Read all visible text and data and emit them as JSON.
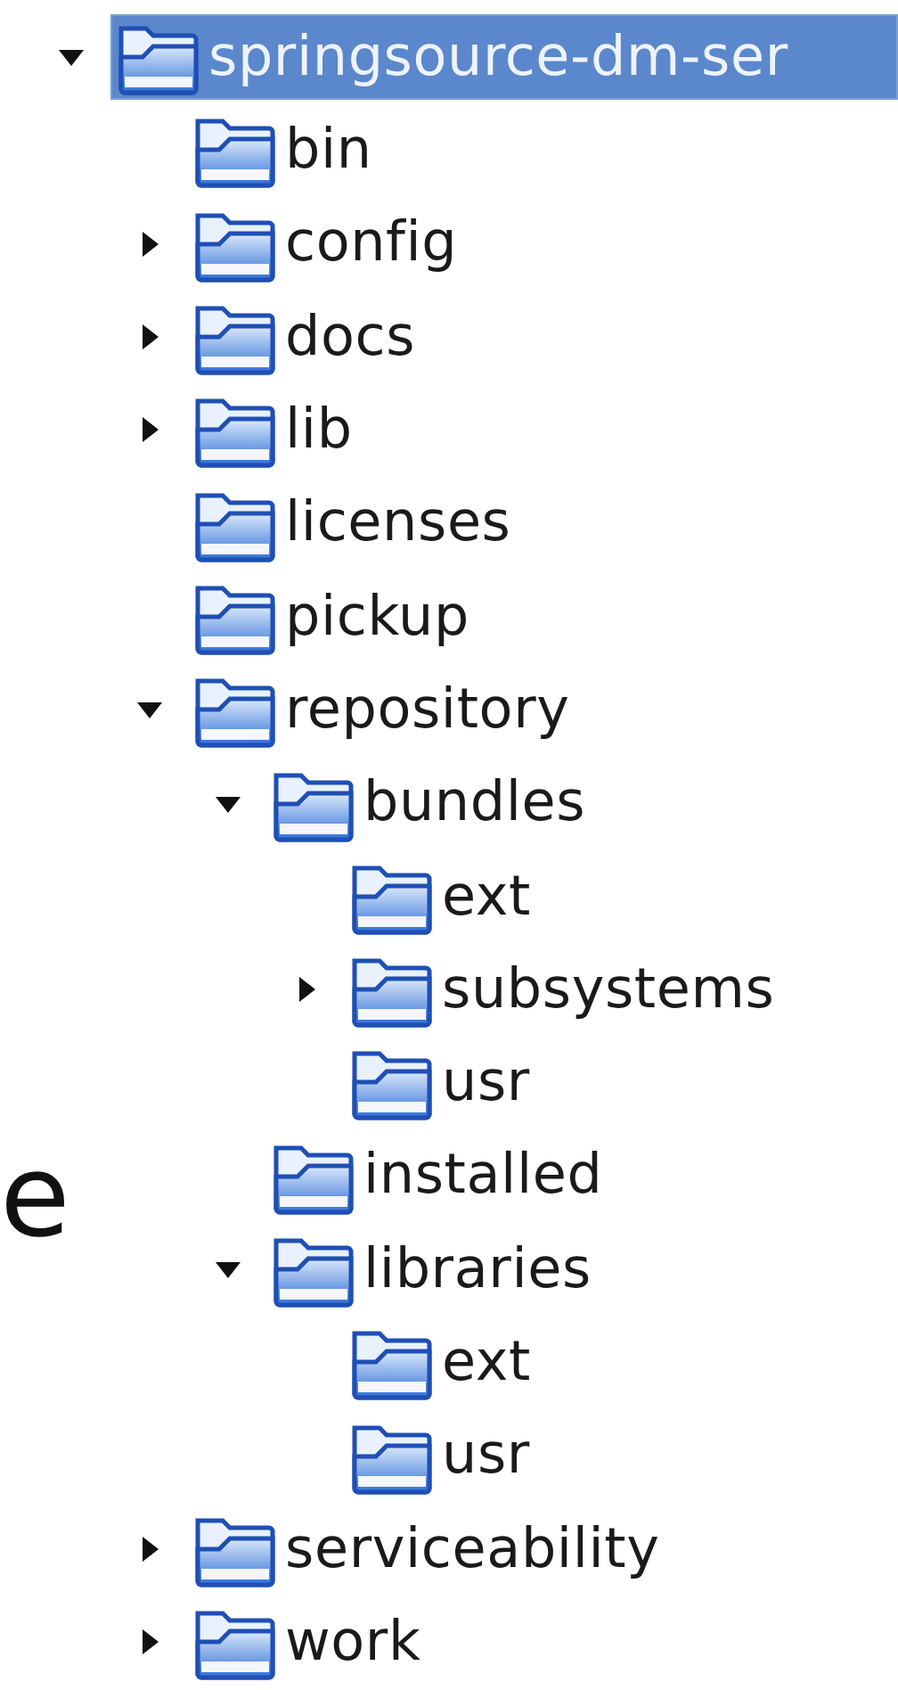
{
  "side_text": "e",
  "tree": [
    {
      "label": "springsource-dm-ser",
      "selected": true,
      "expanded": true,
      "children": [
        {
          "label": "bin",
          "selected": false
        },
        {
          "label": "config",
          "selected": false,
          "expanded": false
        },
        {
          "label": "docs",
          "selected": false,
          "expanded": false
        },
        {
          "label": "lib",
          "selected": false,
          "expanded": false
        },
        {
          "label": "licenses",
          "selected": false
        },
        {
          "label": "pickup",
          "selected": false
        },
        {
          "label": "repository",
          "selected": false,
          "expanded": true,
          "children": [
            {
              "label": "bundles",
              "selected": false,
              "expanded": true,
              "children": [
                {
                  "label": "ext",
                  "selected": false
                },
                {
                  "label": "subsystems",
                  "selected": false,
                  "expanded": false
                },
                {
                  "label": "usr",
                  "selected": false
                }
              ]
            },
            {
              "label": "installed",
              "selected": false
            },
            {
              "label": "libraries",
              "selected": false,
              "expanded": true,
              "children": [
                {
                  "label": "ext",
                  "selected": false
                },
                {
                  "label": "usr",
                  "selected": false
                }
              ]
            }
          ]
        },
        {
          "label": "serviceability",
          "selected": false,
          "expanded": false
        },
        {
          "label": "work",
          "selected": false,
          "expanded": false
        }
      ]
    }
  ]
}
